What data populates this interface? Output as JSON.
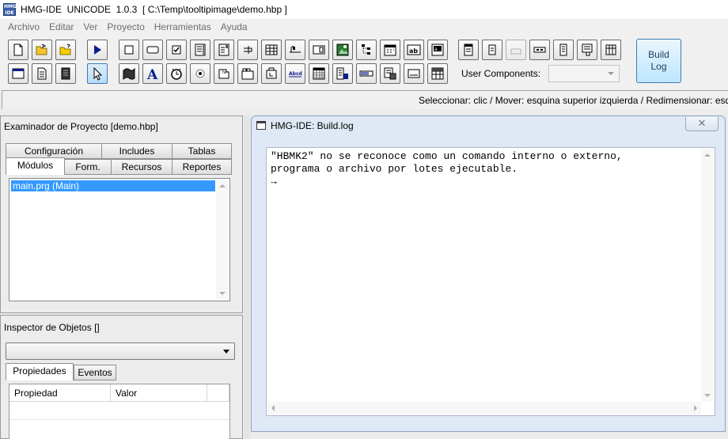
{
  "window": {
    "title": "HMG-IDE  UNICODE  1.0.3  [ C:\\Temp\\tooltipimage\\demo.hbp ]",
    "icon_text": "HMG IDE"
  },
  "menu": [
    "Archivo",
    "Editar",
    "Ver",
    "Proyecto",
    "Herramientas",
    "Ayuda"
  ],
  "toolbar": {
    "row1_left": [
      "new-file-icon",
      "open-folder-icon",
      "open-project-icon",
      "run-icon"
    ],
    "row1_controls": [
      "label-control-icon",
      "button-control-icon",
      "checkbox-control-icon",
      "listbox-control-icon",
      "combobox-control-icon",
      "checkbutton-control-icon",
      "grid-control-icon",
      "slider-control-icon",
      "spinner-control-icon",
      "image-control-icon",
      "tree-control-icon",
      "datepicker-control-icon",
      "textbox-control-icon",
      "editbox-control-icon"
    ],
    "row1_right": [
      "form-properties-icon",
      "control-properties-icon",
      "tab-order-icon",
      "menu-editor-icon",
      "context-menu-icon",
      "notify-menu-icon",
      "toolbar-editor-icon"
    ],
    "row2_left": [
      "form-icon",
      "document-icon",
      "module-icon",
      "pointer-icon"
    ],
    "row2_controls": [
      "frame-control-icon",
      "font-icon",
      "timer-control-icon",
      "radiogroup-control-icon",
      "hyperlink-control-icon",
      "tab-control-icon",
      "animate-control-icon",
      "richedit-control-icon",
      "monthcal-control-icon",
      "ipaddress-control-icon",
      "progressbar-control-icon",
      "player-control-icon",
      "activex-control-icon",
      "browse-control-icon"
    ],
    "user_components_label": "User Components:",
    "user_components_value": "",
    "build_log_label": "Build\nLog"
  },
  "status": {
    "text": "Seleccionar: clic / Mover: esquina superior izquierda / Redimensionar: esquina inferior derecha"
  },
  "project_explorer": {
    "title": "Examinador de Proyecto [demo.hbp]",
    "tabs_row1": [
      "Configuración",
      "Includes",
      "Tablas"
    ],
    "tabs_row2": [
      "Módulos",
      "Form.",
      "Recursos",
      "Reportes"
    ],
    "active_tab": "Módulos",
    "items": [
      "main.prg (Main)"
    ]
  },
  "object_inspector": {
    "title": "Inspector de Objetos []",
    "combo_value": "",
    "tabs": [
      "Propiedades",
      "Eventos"
    ],
    "active_tab": "Propiedades",
    "columns": [
      "Propiedad",
      "Valor"
    ]
  },
  "build_log": {
    "title": "HMG-IDE: Build.log",
    "close": "✕",
    "lines": [
      "\"HBMK2\" no se reconoce como un comando interno o externo,",
      "programa o archivo por lotes ejecutable.",
      "→"
    ]
  }
}
